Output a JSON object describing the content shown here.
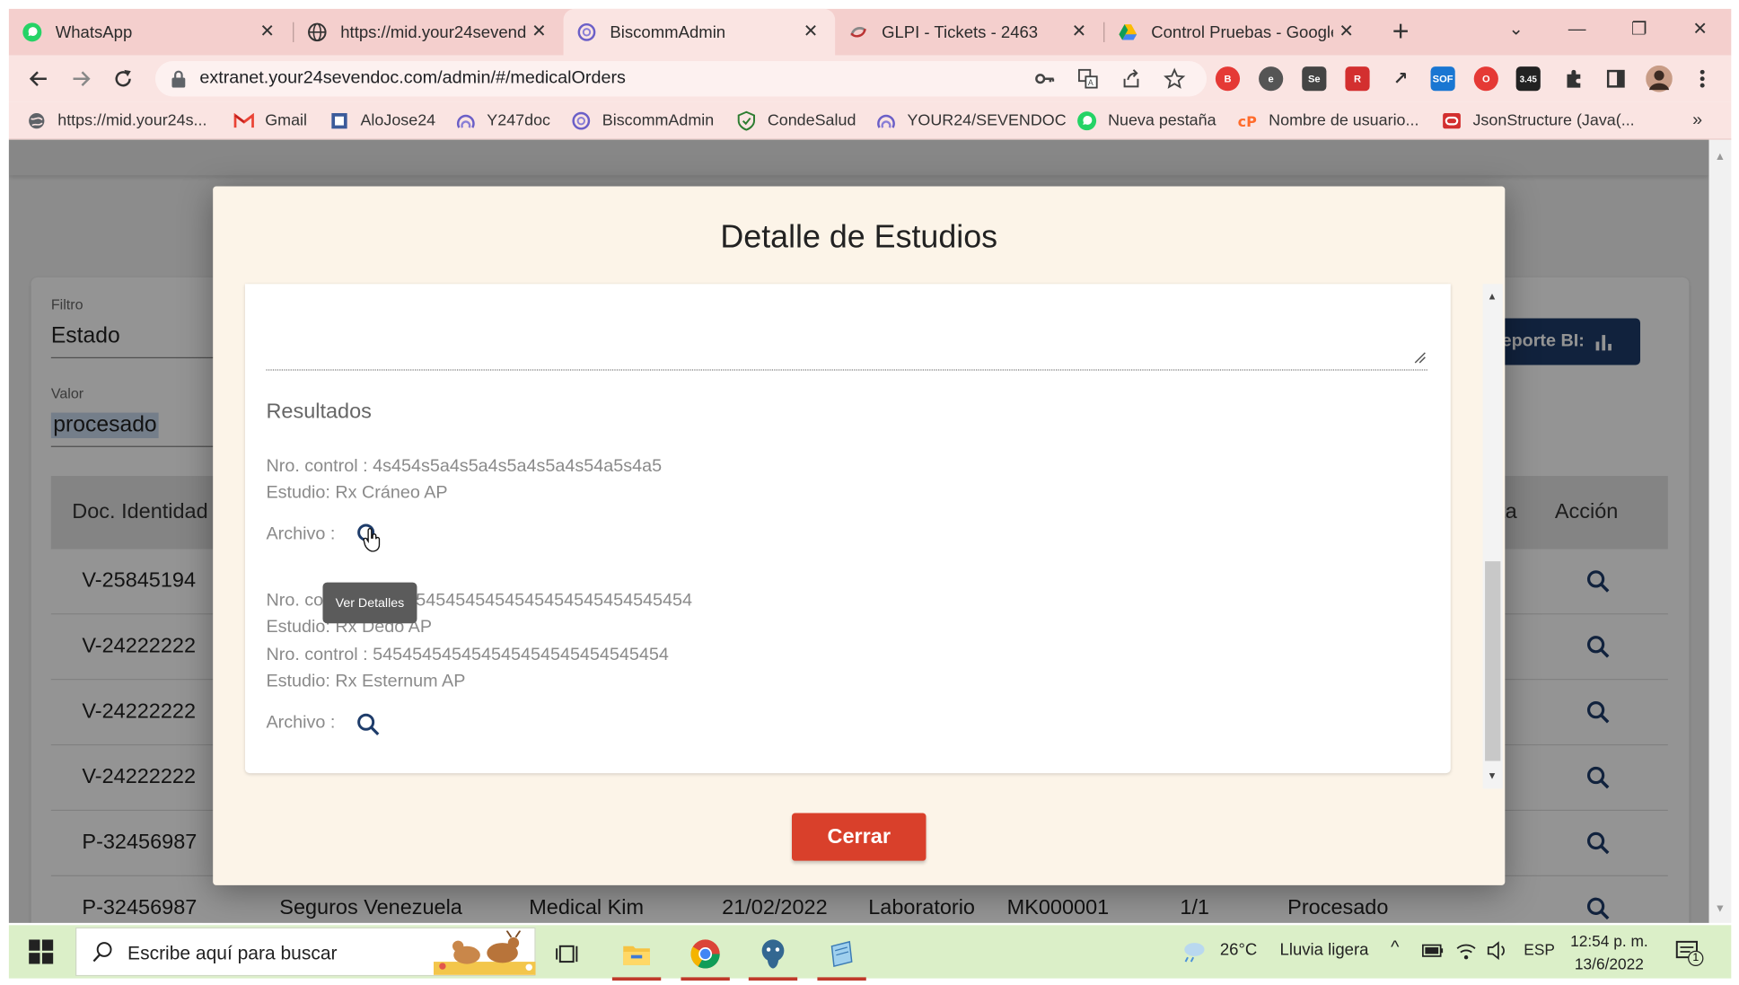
{
  "browser": {
    "tabs": [
      {
        "title": "WhatsApp",
        "icon": "whatsapp-icon",
        "active": false
      },
      {
        "title": "https://mid.your24sevend",
        "icon": "globe-icon",
        "active": false
      },
      {
        "title": "BiscommAdmin",
        "icon": "biscomm-icon",
        "active": true
      },
      {
        "title": "GLPI - Tickets - 2463",
        "icon": "glpi-icon",
        "active": false
      },
      {
        "title": "Control Pruebas - Google",
        "icon": "google-drive-icon",
        "active": false
      }
    ],
    "url": "extranet.your24sevendoc.com/admin/#/medicalOrders",
    "extensions": [
      {
        "label": "B",
        "color": "#e53935"
      },
      {
        "label": "e",
        "color": "#555555"
      },
      {
        "label": "Se",
        "color": "#444444"
      },
      {
        "label": "R",
        "color": "#d32f2f"
      },
      {
        "label": "↗",
        "color": "#333333"
      },
      {
        "label": "SOF",
        "color": "#1976d2"
      },
      {
        "label": "O",
        "color": "#e53935"
      },
      {
        "label": "3.45",
        "color": "#222222"
      }
    ],
    "bookmarks": [
      {
        "label": "https://mid.your24s...",
        "icon": "globe-icon"
      },
      {
        "label": "Gmail",
        "icon": "gmail-icon"
      },
      {
        "label": "AloJose24",
        "icon": "bookmark-page-icon"
      },
      {
        "label": "Y247doc",
        "icon": "y247-icon"
      },
      {
        "label": "BiscommAdmin",
        "icon": "biscomm-icon"
      },
      {
        "label": "CondeSalud",
        "icon": "shield-icon"
      },
      {
        "label": "YOUR24/SEVENDOC",
        "icon": "y247-icon"
      },
      {
        "label": "Nueva pestaña",
        "icon": "whatsapp-icon"
      },
      {
        "label": "Nombre de usuario...",
        "icon": "cpanel-icon"
      },
      {
        "label": "JsonStructure (Java(...",
        "icon": "oracle-icon"
      }
    ],
    "bookmarks_more": "»"
  },
  "page": {
    "filter_label": "Filtro",
    "filter_value": "Estado",
    "value_label": "Valor",
    "value_value": "procesado",
    "report_button": "eporte BI:",
    "table": {
      "headers": [
        "Doc. Identidad",
        "ta",
        "Acción"
      ],
      "rows": [
        {
          "doc": "V-25845194"
        },
        {
          "doc": "V-24222222"
        },
        {
          "doc": "V-24222222"
        },
        {
          "doc": "V-24222222"
        },
        {
          "doc": "P-32456987"
        },
        {
          "doc": "P-32456987",
          "insurer": "Seguros Venezuela",
          "provider": "Medical Kim",
          "date": "21/02/2022",
          "type": "Laboratorio",
          "code": "MK000001",
          "count": "1/1",
          "status": "Procesado"
        }
      ]
    }
  },
  "modal": {
    "title": "Detalle de Estudios",
    "results_title": "Resultados",
    "group1": {
      "control": "Nro. control : 4s454s5a4s5a4s5a4s5a4s54a5s4a5",
      "study": "Estudio: Rx Cráneo AP",
      "archivo_label": "Archivo :"
    },
    "group2": {
      "control1_prefix": "Nro. co",
      "control1_suffix": "5454545454545454545454545454",
      "study1": "Estudio: Rx Dedo AP",
      "control2": "Nro. control : 545454545454545454545454545454",
      "study2": "Estudio: Rx Esternum AP",
      "archivo_label": "Archivo :"
    },
    "tooltip": "Ver Detalles",
    "close_button": "Cerrar"
  },
  "taskbar": {
    "search_placeholder": "Escribe aquí para buscar",
    "weather_temp": "26°C",
    "weather_desc": "Lluvia ligera",
    "language": "ESP",
    "time": "12:54 p. m.",
    "date": "13/6/2022",
    "notification_count": "1"
  },
  "colors": {
    "tabstrip": "#f4cfcd",
    "toolbar": "#fae4e2",
    "modal_bg": "#fcf4e8",
    "close_button": "#d9402b",
    "report_button": "#1e3c6a",
    "taskbar": "#dbefc8"
  }
}
